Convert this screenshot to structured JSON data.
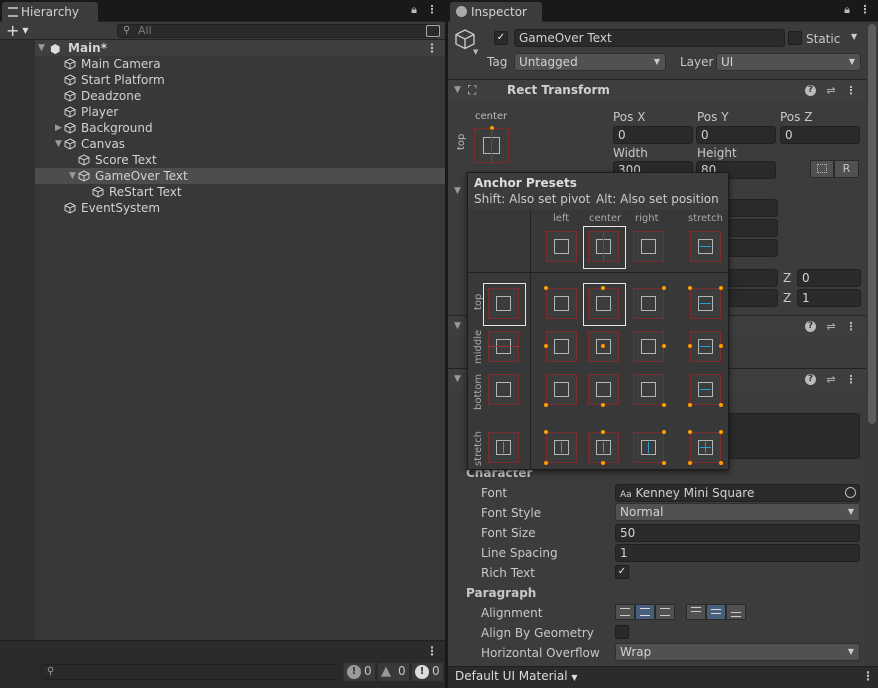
{
  "hierarchy": {
    "tab": "Hierarchy",
    "add_label": "+",
    "search_placeholder": "All",
    "scene": "Main*",
    "items": [
      {
        "label": "Main Camera"
      },
      {
        "label": "Start Platform"
      },
      {
        "label": "Deadzone"
      },
      {
        "label": "Player"
      },
      {
        "label": "Background"
      },
      {
        "label": "Canvas"
      },
      {
        "label": "Score Text"
      },
      {
        "label": "GameOver Text"
      },
      {
        "label": "ReStart Text"
      },
      {
        "label": "EventSystem"
      }
    ],
    "console_counts": {
      "info": "0",
      "warn": "0",
      "error": "0"
    }
  },
  "inspector": {
    "tab": "Inspector",
    "object_name": "GameOver Text",
    "static_label": "Static",
    "tag_label": "Tag",
    "tag_value": "Untagged",
    "layer_label": "Layer",
    "layer_value": "UI",
    "rect_transform": {
      "title": "Rect Transform",
      "anchor_h": "center",
      "anchor_v": "top",
      "pos_x_label": "Pos X",
      "pos_x": "0",
      "pos_y_label": "Pos Y",
      "pos_y": "0",
      "pos_z_label": "Pos Z",
      "pos_z": "0",
      "width_label": "Width",
      "width": "300",
      "height_label": "Height",
      "height": "80",
      "raw_label": "R",
      "z1_label": "Z",
      "z1": "0",
      "z2_label": "Z",
      "z2": "1"
    },
    "text": {
      "character_header": "Character",
      "font_label": "Font",
      "font_value": "Kenney Mini Square",
      "font_prefix": "Aa",
      "style_label": "Font Style",
      "style_value": "Normal",
      "size_label": "Font Size",
      "size_value": "50",
      "spacing_label": "Line Spacing",
      "spacing_value": "1",
      "rich_label": "Rich Text",
      "rich_checked": "✓",
      "paragraph_header": "Paragraph",
      "alignment_label": "Alignment",
      "geometry_label": "Align By Geometry",
      "overflow_label": "Horizontal Overflow",
      "overflow_value": "Wrap"
    },
    "material_label": "Default UI Material"
  },
  "anchor_presets": {
    "title": "Anchor Presets",
    "hint_shift": "Shift: Also set pivot",
    "hint_alt": "Alt: Also set position",
    "cols": [
      "left",
      "center",
      "right",
      "stretch"
    ],
    "rows": [
      "top",
      "middle",
      "bottom",
      "stretch"
    ]
  },
  "colors": {
    "accent_orange": "#ff9d00",
    "anchor_red": "#9a3636",
    "stretch_blue": "#29a0d4",
    "selected_row": "#4d4d4d"
  }
}
